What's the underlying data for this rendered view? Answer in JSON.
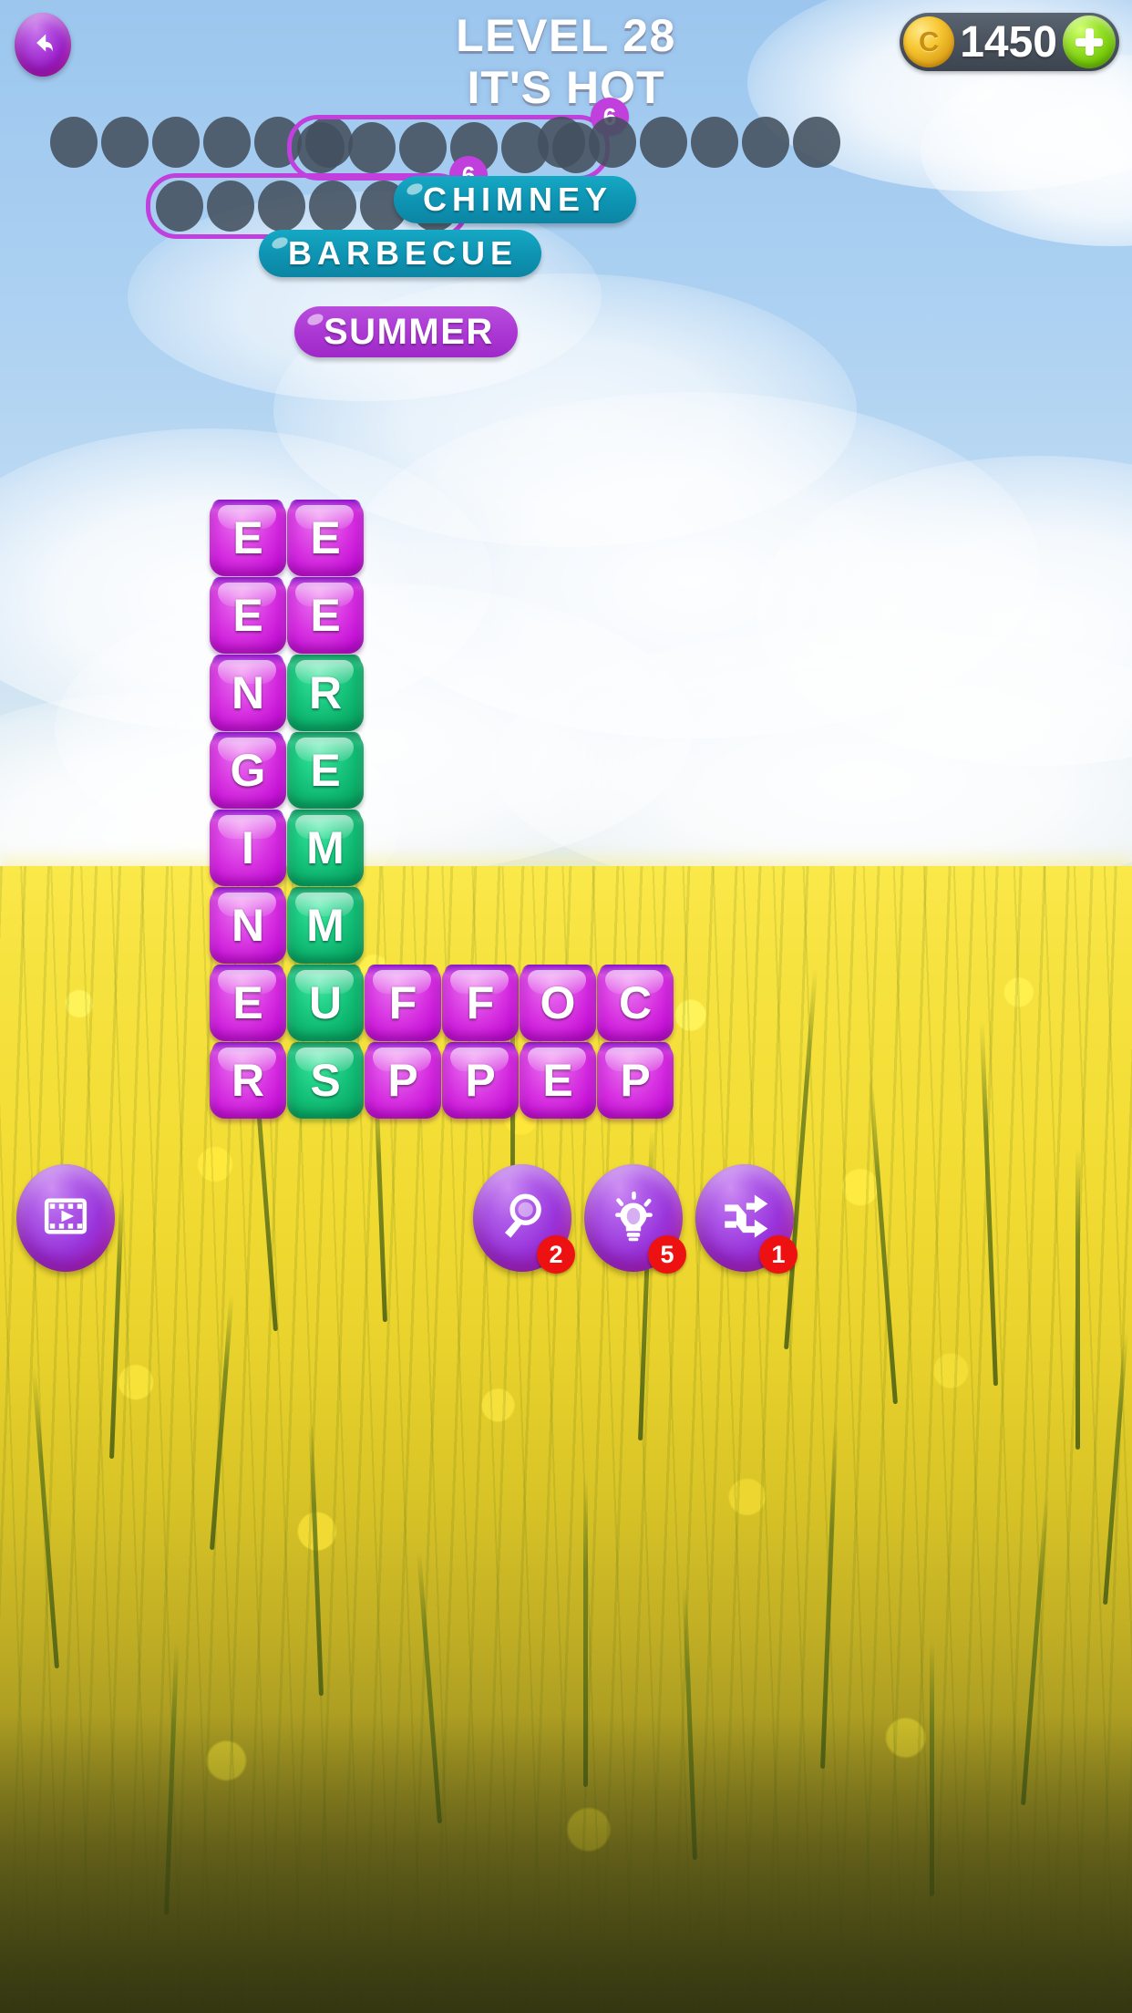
{
  "header": {
    "level_label": "LEVEL 28",
    "theme_label": "IT'S HOT",
    "back_icon": "back-arrow-icon",
    "coins": {
      "value": "1450",
      "coin_icon": "coin-icon",
      "coin_glyph": "C",
      "add_label": "+"
    }
  },
  "word_slots": {
    "rows": [
      {
        "groups": [
          {
            "dots": 6,
            "highlighted": false,
            "count_label": ""
          },
          {
            "dots": 6,
            "highlighted": true,
            "count_label": "6"
          },
          {
            "dots": 6,
            "highlighted": false,
            "count_label": ""
          }
        ]
      },
      {
        "groups": [
          {
            "dots": 6,
            "highlighted": true,
            "count_label": "6"
          }
        ]
      }
    ]
  },
  "found_words": [
    {
      "text": "CHIMNEY",
      "color": "#0e93b2",
      "style": "teal"
    },
    {
      "text": "BARBECUE",
      "color": "#0e93b2",
      "style": "teal"
    },
    {
      "text": "SUMMER",
      "color": "#ab37d3",
      "style": "purple"
    }
  ],
  "grid": {
    "columns": 6,
    "rows": 8,
    "cells": [
      [
        {
          "letter": "E",
          "color": "magenta"
        },
        {
          "letter": "E",
          "color": "magenta"
        },
        null,
        null,
        null,
        null
      ],
      [
        {
          "letter": "E",
          "color": "magenta"
        },
        {
          "letter": "E",
          "color": "magenta"
        },
        null,
        null,
        null,
        null
      ],
      [
        {
          "letter": "N",
          "color": "magenta"
        },
        {
          "letter": "R",
          "color": "green"
        },
        null,
        null,
        null,
        null
      ],
      [
        {
          "letter": "G",
          "color": "magenta"
        },
        {
          "letter": "E",
          "color": "green"
        },
        null,
        null,
        null,
        null
      ],
      [
        {
          "letter": "I",
          "color": "magenta"
        },
        {
          "letter": "M",
          "color": "green"
        },
        null,
        null,
        null,
        null
      ],
      [
        {
          "letter": "N",
          "color": "magenta"
        },
        {
          "letter": "M",
          "color": "green"
        },
        null,
        null,
        null,
        null
      ],
      [
        {
          "letter": "E",
          "color": "magenta"
        },
        {
          "letter": "U",
          "color": "green"
        },
        {
          "letter": "F",
          "color": "magenta"
        },
        {
          "letter": "F",
          "color": "magenta"
        },
        {
          "letter": "O",
          "color": "magenta"
        },
        {
          "letter": "C",
          "color": "magenta"
        }
      ],
      [
        {
          "letter": "R",
          "color": "magenta"
        },
        {
          "letter": "S",
          "color": "green"
        },
        {
          "letter": "P",
          "color": "magenta"
        },
        {
          "letter": "P",
          "color": "magenta"
        },
        {
          "letter": "E",
          "color": "magenta"
        },
        {
          "letter": "P",
          "color": "magenta"
        }
      ]
    ]
  },
  "actions": {
    "video": {
      "icon": "video-reward-icon",
      "badge": ""
    },
    "tools": [
      {
        "icon": "magnifier-icon",
        "badge": "2"
      },
      {
        "icon": "lightbulb-icon",
        "badge": "5"
      },
      {
        "icon": "shuffle-icon",
        "badge": "1"
      }
    ]
  },
  "colors": {
    "accent_purple": "#c13fdd",
    "tile_magenta": "#d62fe0",
    "tile_green": "#12bd76",
    "pill_teal": "#0e93b2",
    "badge_red": "#ee1111"
  }
}
